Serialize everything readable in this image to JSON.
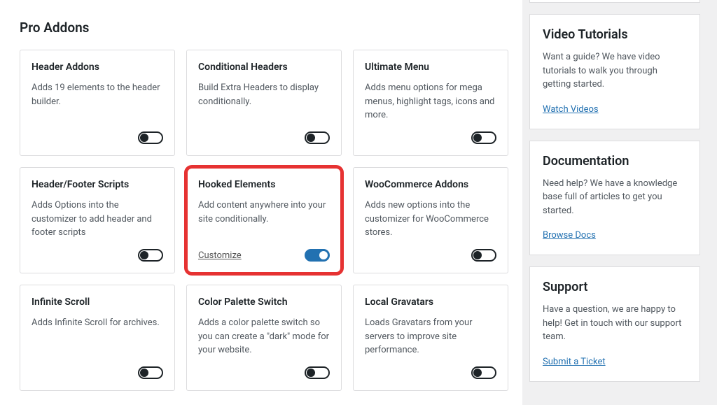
{
  "section_title": "Pro Addons",
  "addons": [
    {
      "title": "Header Addons",
      "desc": "Adds 19 elements to the header builder.",
      "on": false,
      "link": null
    },
    {
      "title": "Conditional Headers",
      "desc": "Build Extra Headers to display conditionally.",
      "on": false,
      "link": null
    },
    {
      "title": "Ultimate Menu",
      "desc": "Adds menu options for mega menus, highlight tags, icons and more.",
      "on": false,
      "link": null
    },
    {
      "title": "Header/Footer Scripts",
      "desc": "Adds Options into the customizer to add header and footer scripts",
      "on": false,
      "link": null
    },
    {
      "title": "Hooked Elements",
      "desc": "Add content anywhere into your site conditionally.",
      "on": true,
      "link": "Customize",
      "highlighted": true
    },
    {
      "title": "WooCommerce Addons",
      "desc": "Adds new options into the customizer for WooCommerce stores.",
      "on": false,
      "link": null
    },
    {
      "title": "Infinite Scroll",
      "desc": "Adds Infinite Scroll for archives.",
      "on": false,
      "link": null
    },
    {
      "title": "Color Palette Switch",
      "desc": "Adds a color palette switch so you can create a \"dark\" mode for your website.",
      "on": false,
      "link": null
    },
    {
      "title": "Local Gravatars",
      "desc": "Loads Gravatars from your servers to improve site performance.",
      "on": false,
      "link": null
    }
  ],
  "sidebar": {
    "video": {
      "title": "Video Tutorials",
      "desc": "Want a guide? We have video tutorials to walk you through getting started.",
      "link": "Watch Videos"
    },
    "docs": {
      "title": "Documentation",
      "desc": "Need help? We have a knowledge base full of articles to get you started.",
      "link": "Browse Docs"
    },
    "support": {
      "title": "Support",
      "desc": "Have a question, we are happy to help! Get in touch with our support team.",
      "link": "Submit a Ticket"
    }
  }
}
